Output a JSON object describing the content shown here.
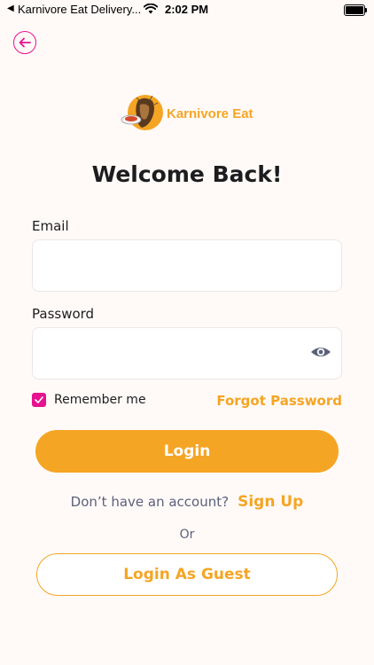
{
  "status_bar": {
    "back_glyph": "◀",
    "app_name": "Karnivore Eat Delivery...",
    "time": "2:02 PM"
  },
  "logo": {
    "text": "Karnivore Eat"
  },
  "title": "Welcome Back!",
  "email": {
    "label": "Email",
    "value": "",
    "placeholder": ""
  },
  "password": {
    "label": "Password",
    "value": "",
    "placeholder": ""
  },
  "remember_me": {
    "label": "Remember me",
    "checked": true
  },
  "forgot_password": "Forgot Password",
  "login_button": "Login",
  "signup": {
    "prompt": "Don’t have an account?",
    "link": "Sign Up"
  },
  "or_text": "Or",
  "guest_button": "Login As Guest",
  "colors": {
    "accent": "#f5a524",
    "pink": "#e7128f",
    "background": "#fffaf8"
  },
  "icons": {
    "back": "arrow-left-icon",
    "password_toggle": "eye-icon",
    "checkbox": "checkmark-icon"
  }
}
